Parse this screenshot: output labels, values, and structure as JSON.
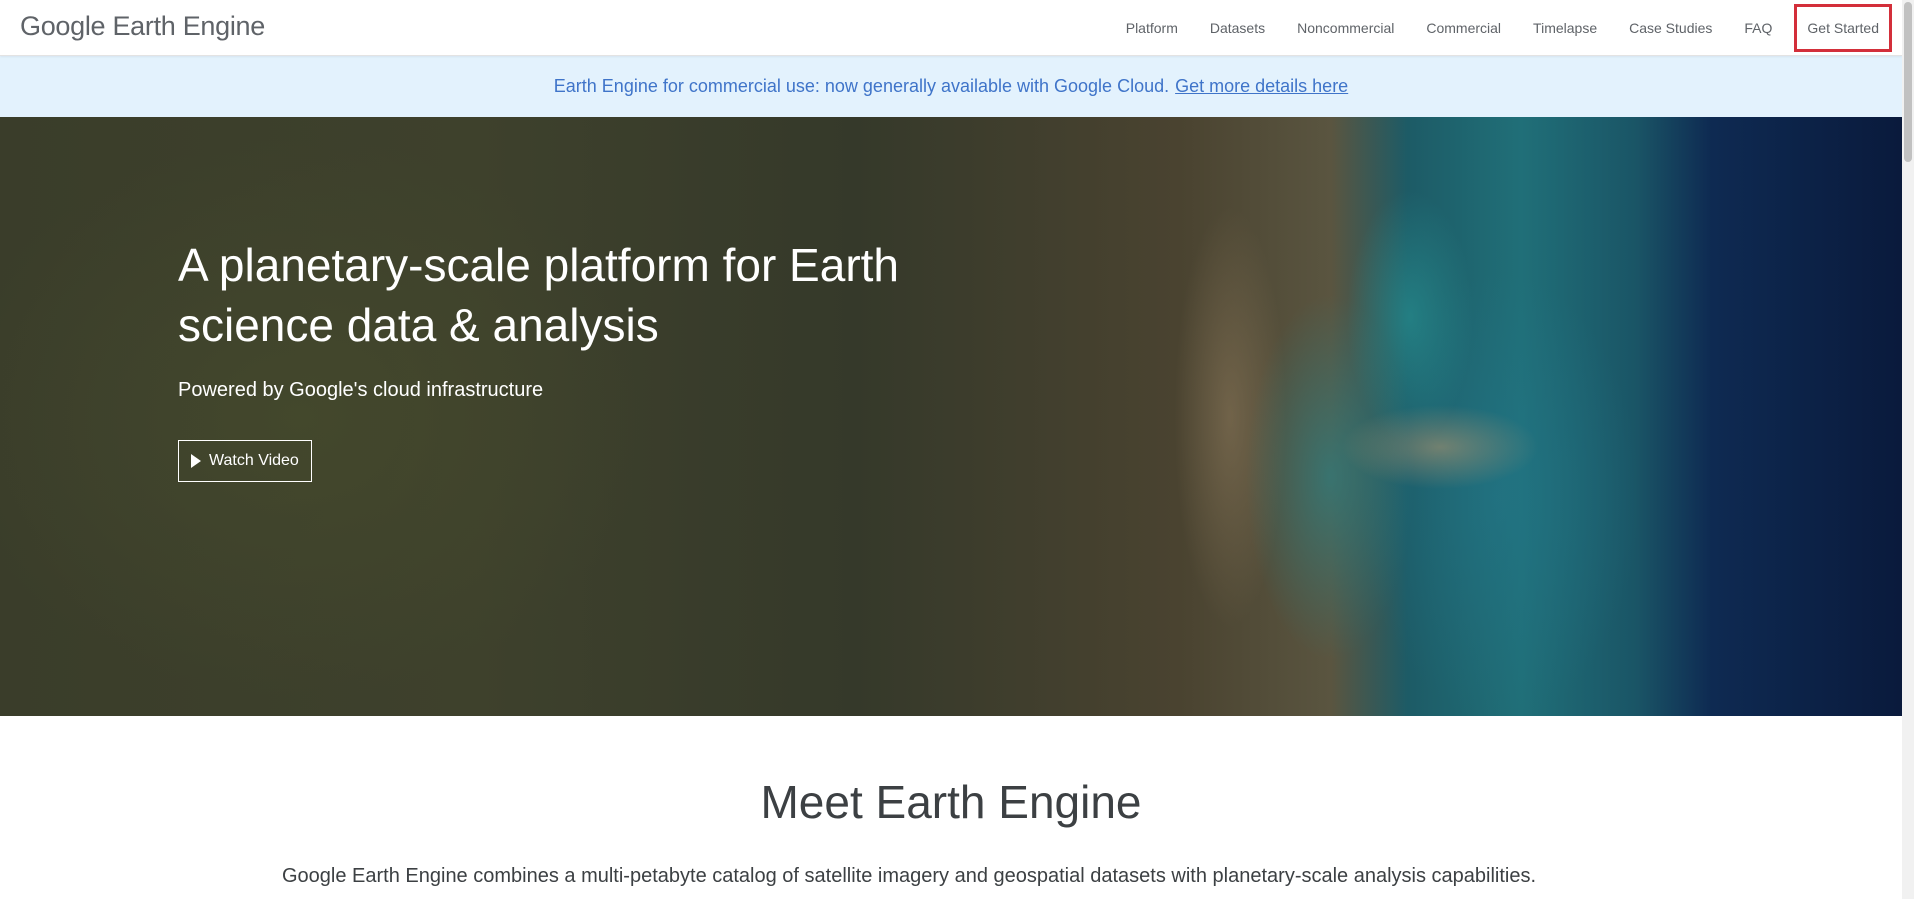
{
  "header": {
    "logo_google": "Google",
    "logo_product": "Earth Engine",
    "nav": [
      {
        "label": "Platform"
      },
      {
        "label": "Datasets"
      },
      {
        "label": "Noncommercial"
      },
      {
        "label": "Commercial"
      },
      {
        "label": "Timelapse"
      },
      {
        "label": "Case Studies"
      },
      {
        "label": "FAQ"
      }
    ],
    "cta_label": "Get Started"
  },
  "banner": {
    "text": "Earth Engine for commercial use: now generally available with Google Cloud.",
    "link_label": "Get more details here"
  },
  "hero": {
    "title": "A planetary-scale platform for Earth science data & analysis",
    "subtitle": "Powered by Google's cloud infrastructure",
    "button_label": "Watch Video"
  },
  "meet": {
    "title": "Meet Earth Engine",
    "body": "Google Earth Engine combines a multi-petabyte catalog of satellite imagery and geospatial datasets with planetary-scale analysis capabilities."
  },
  "colors": {
    "banner_bg": "#e3f2fd",
    "banner_text": "#3f74c9",
    "cta_highlight": "#d32f3a",
    "nav_text": "#5f6368"
  },
  "icons": {
    "play": "play-icon"
  }
}
